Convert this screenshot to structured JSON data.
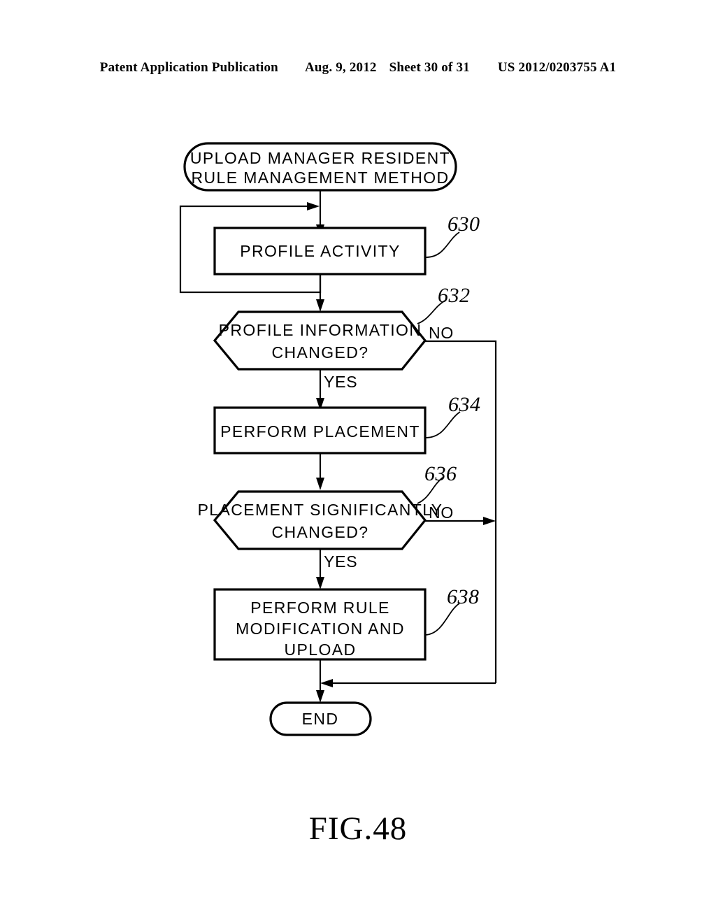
{
  "header": {
    "publication": "Patent Application Publication",
    "date": "Aug. 9, 2012",
    "sheet": "Sheet 30 of 31",
    "number": "US 2012/0203755 A1"
  },
  "figure": {
    "caption": "FIG.48"
  },
  "flowchart": {
    "start": {
      "line1": "UPLOAD MANAGER RESIDENT",
      "line2": "RULE MANAGEMENT METHOD"
    },
    "step_630": {
      "ref": "630",
      "line1": "PROFILE ACTIVITY"
    },
    "decision_632": {
      "ref": "632",
      "line1": "PROFILE INFORMATION",
      "line2": "CHANGED?",
      "yes_label": "YES",
      "no_label": "NO"
    },
    "step_634": {
      "ref": "634",
      "line1": "PERFORM PLACEMENT"
    },
    "decision_636": {
      "ref": "636",
      "line1": "PLACEMENT SIGNIFICANTLY",
      "line2": "CHANGED?",
      "yes_label": "YES",
      "no_label": "NO"
    },
    "step_638": {
      "ref": "638",
      "line1": "PERFORM RULE",
      "line2": "MODIFICATION AND",
      "line3": "UPLOAD"
    },
    "end": {
      "label": "END"
    }
  },
  "colors": {
    "ink": "#000000",
    "paper": "#ffffff"
  }
}
